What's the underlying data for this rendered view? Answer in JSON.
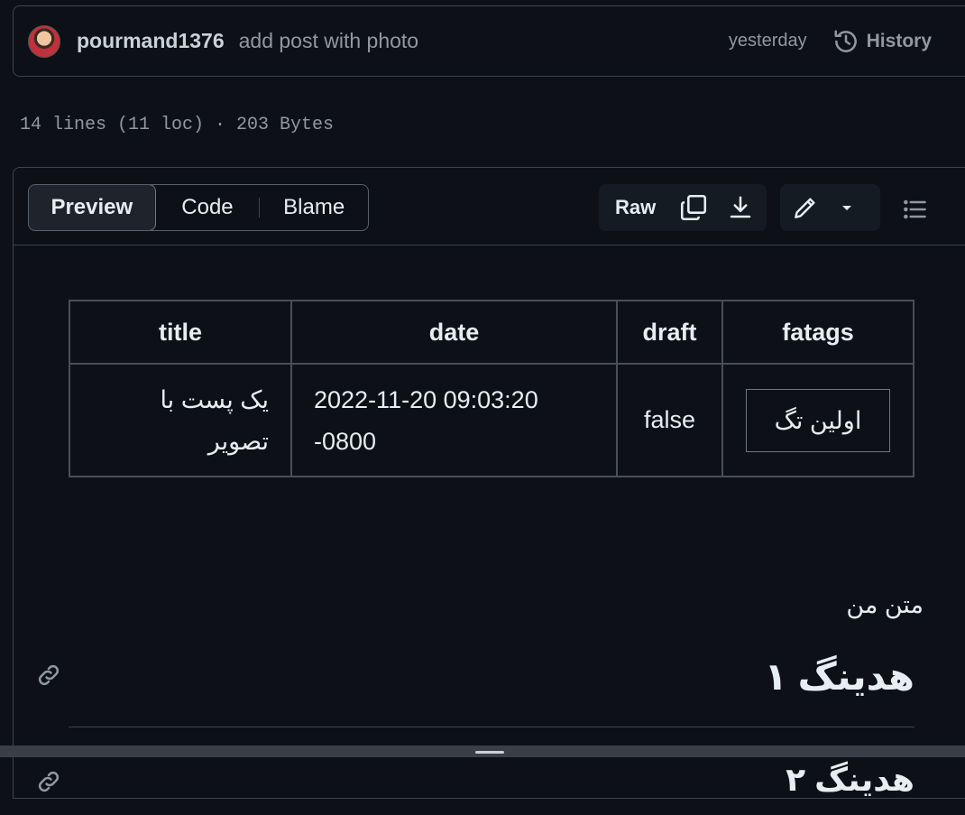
{
  "commit": {
    "author": "pourmand1376",
    "message": "add post with photo",
    "time": "yesterday",
    "history_label": "History"
  },
  "file_info": "14 lines (11 loc) · 203 Bytes",
  "toolbar": {
    "tabs": [
      "Preview",
      "Code",
      "Blame"
    ],
    "raw_label": "Raw",
    "icons": [
      "copy-icon",
      "download-icon",
      "pencil-icon",
      "triangle-down-icon",
      "list-icon"
    ]
  },
  "front_matter": {
    "headers": [
      "title",
      "date",
      "draft",
      "fatags"
    ],
    "row": {
      "title_line1": "یک پست با",
      "title_line2": "تصویر",
      "date_line1": "2022-11-20 09:03:20",
      "date_line2": "-0800",
      "draft": "false",
      "tag": "اولین تگ"
    }
  },
  "body": {
    "paragraph": "متن من",
    "heading1": "هدینگ ۱",
    "heading2": "هدینگ ۲"
  }
}
